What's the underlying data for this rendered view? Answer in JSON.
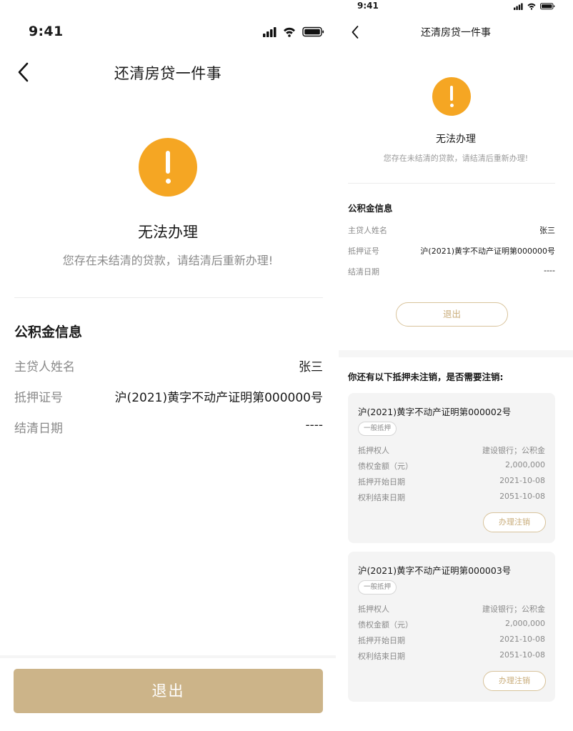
{
  "left": {
    "status_bar": {
      "time": "9:41"
    },
    "nav": {
      "title": "还清房贷一件事"
    },
    "result": {
      "status": "无法办理",
      "message": "您存在未结清的贷款，请结清后重新办理!"
    },
    "section_title": "公积金信息",
    "info": [
      {
        "label": "主贷人姓名",
        "value": "张三"
      },
      {
        "label": "抵押证号",
        "value": "沪(2021)黄字不动产证明第000000号"
      },
      {
        "label": "结清日期",
        "value": "----"
      }
    ],
    "exit_label": "退出"
  },
  "right": {
    "status_bar": {
      "time": "9:41"
    },
    "nav": {
      "title": "还清房贷一件事"
    },
    "result": {
      "status": "无法办理",
      "message": "您存在未结清的贷款，请结清后重新办理!"
    },
    "section_title": "公积金信息",
    "info": [
      {
        "label": "主贷人姓名",
        "value": "张三"
      },
      {
        "label": "抵押证号",
        "value": "沪(2021)黄字不动产证明第000000号"
      },
      {
        "label": "结清日期",
        "value": "----"
      }
    ],
    "exit_label": "退出",
    "question": "你还有以下抵押未注销，是否需要注销:",
    "cards": [
      {
        "cert": "沪(2021)黄字不动产证明第000002号",
        "tag": "一般抵押",
        "rows": [
          {
            "label": "抵押权人",
            "value": "建设银行；公积金"
          },
          {
            "label": "债权金额（元）",
            "value": "2,000,000"
          },
          {
            "label": "抵押开始日期",
            "value": "2021-10-08"
          },
          {
            "label": "权利结束日期",
            "value": "2051-10-08"
          }
        ],
        "action": "办理注销"
      },
      {
        "cert": "沪(2021)黄字不动产证明第000003号",
        "tag": "一般抵押",
        "rows": [
          {
            "label": "抵押权人",
            "value": "建设银行；公积金"
          },
          {
            "label": "债权金额（元）",
            "value": "2,000,000"
          },
          {
            "label": "抵押开始日期",
            "value": "2021-10-08"
          },
          {
            "label": "权利结束日期",
            "value": "2051-10-08"
          }
        ],
        "action": "办理注销"
      }
    ]
  },
  "colors": {
    "warning": "#f5a623",
    "primary_button": "#ccb489",
    "outline_accent": "#c9ad7b",
    "label_gray": "#8a8a8a",
    "card_bg": "#f4f4f4"
  }
}
